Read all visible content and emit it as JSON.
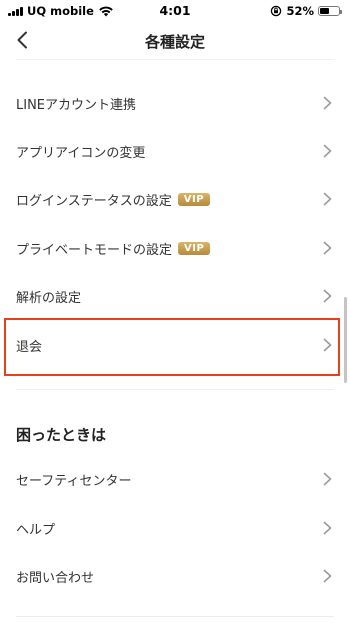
{
  "status_bar": {
    "carrier": "UQ mobile",
    "time": "4:01",
    "battery": "52%",
    "battery_level": 0.52
  },
  "nav": {
    "title": "各種設定",
    "back_icon": "chevron-left-icon"
  },
  "settings": {
    "items": [
      {
        "label": "LINEアカウント連携",
        "vip": ""
      },
      {
        "label": "アプリアイコンの変更",
        "vip": ""
      },
      {
        "label": "ログインステータスの設定",
        "vip": "VIP"
      },
      {
        "label": "プライベートモードの設定",
        "vip": "VIP"
      },
      {
        "label": "解析の設定",
        "vip": ""
      },
      {
        "label": "退会",
        "vip": ""
      }
    ]
  },
  "help_section": {
    "heading": "困ったときは",
    "items": [
      {
        "label": "セーフティセンター"
      },
      {
        "label": "ヘルプ"
      },
      {
        "label": "お問い合わせ"
      }
    ]
  },
  "colors": {
    "highlight": "#e8401c",
    "vip_badge": "#c99e52"
  }
}
